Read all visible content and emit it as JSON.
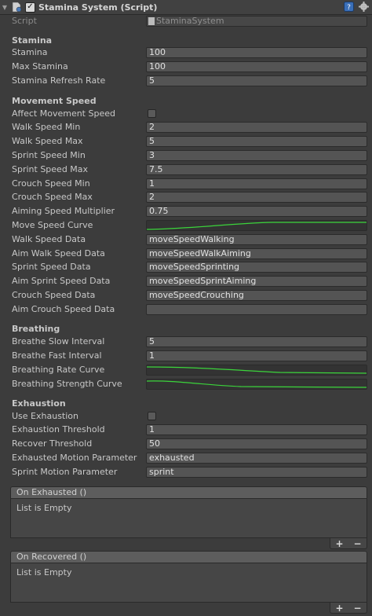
{
  "header": {
    "title": "Stamina System (Script)",
    "enabled": true,
    "icons": [
      "component-script-icon",
      "help-icon",
      "settings-gear-icon"
    ]
  },
  "script": {
    "label": "Script",
    "value": "StaminaSystem"
  },
  "stamina": {
    "heading": "Stamina",
    "stamina_label": "Stamina",
    "stamina_value": "100",
    "max_label": "Max Stamina",
    "max_value": "100",
    "refresh_label": "Stamina Refresh Rate",
    "refresh_value": "5"
  },
  "movement": {
    "heading": "Movement Speed",
    "affect_label": "Affect Movement Speed",
    "affect_checked": false,
    "walk_min_label": "Walk Speed Min",
    "walk_min_value": "2",
    "walk_max_label": "Walk Speed Max",
    "walk_max_value": "5",
    "sprint_min_label": "Sprint Speed Min",
    "sprint_min_value": "3",
    "sprint_max_label": "Sprint Speed Max",
    "sprint_max_value": "7.5",
    "crouch_min_label": "Crouch Speed Min",
    "crouch_min_value": "1",
    "crouch_max_label": "Crouch Speed Max",
    "crouch_max_value": "2",
    "aim_mult_label": "Aiming Speed Multiplier",
    "aim_mult_value": "0.75",
    "curve_label": "Move Speed Curve",
    "walk_data_label": "Walk Speed Data",
    "walk_data_value": "moveSpeedWalking",
    "aim_walk_label": "Aim Walk Speed Data",
    "aim_walk_value": "moveSpeedWalkAiming",
    "sprint_data_label": "Sprint Speed Data",
    "sprint_data_value": "moveSpeedSprinting",
    "aim_sprint_label": "Aim Sprint Speed Data",
    "aim_sprint_value": "moveSpeedSprintAiming",
    "crouch_data_label": "Crouch Speed Data",
    "crouch_data_value": "moveSpeedCrouching",
    "aim_crouch_label": "Aim Crouch Speed Data",
    "aim_crouch_value": ""
  },
  "breathing": {
    "heading": "Breathing",
    "slow_label": "Breathe Slow Interval",
    "slow_value": "5",
    "fast_label": "Breathe Fast Interval",
    "fast_value": "1",
    "rate_curve_label": "Breathing Rate Curve",
    "strength_curve_label": "Breathing Strength Curve"
  },
  "exhaustion": {
    "heading": "Exhaustion",
    "use_label": "Use Exhaustion",
    "use_checked": false,
    "threshold_label": "Exhaustion Threshold",
    "threshold_value": "1",
    "recover_label": "Recover Threshold",
    "recover_value": "50",
    "exhausted_param_label": "Exhausted Motion Parameter",
    "exhausted_param_value": "exhausted",
    "sprint_param_label": "Sprint Motion Parameter",
    "sprint_param_value": "sprint"
  },
  "events": {
    "on_exhausted": {
      "title": "On Exhausted ()",
      "empty": "List is Empty",
      "add": "+",
      "remove": "−"
    },
    "on_recovered": {
      "title": "On Recovered ()",
      "empty": "List is Empty",
      "add": "+",
      "remove": "−"
    }
  },
  "colors": {
    "curve_line": "#3bd43b",
    "background": "#3c3c3c"
  }
}
